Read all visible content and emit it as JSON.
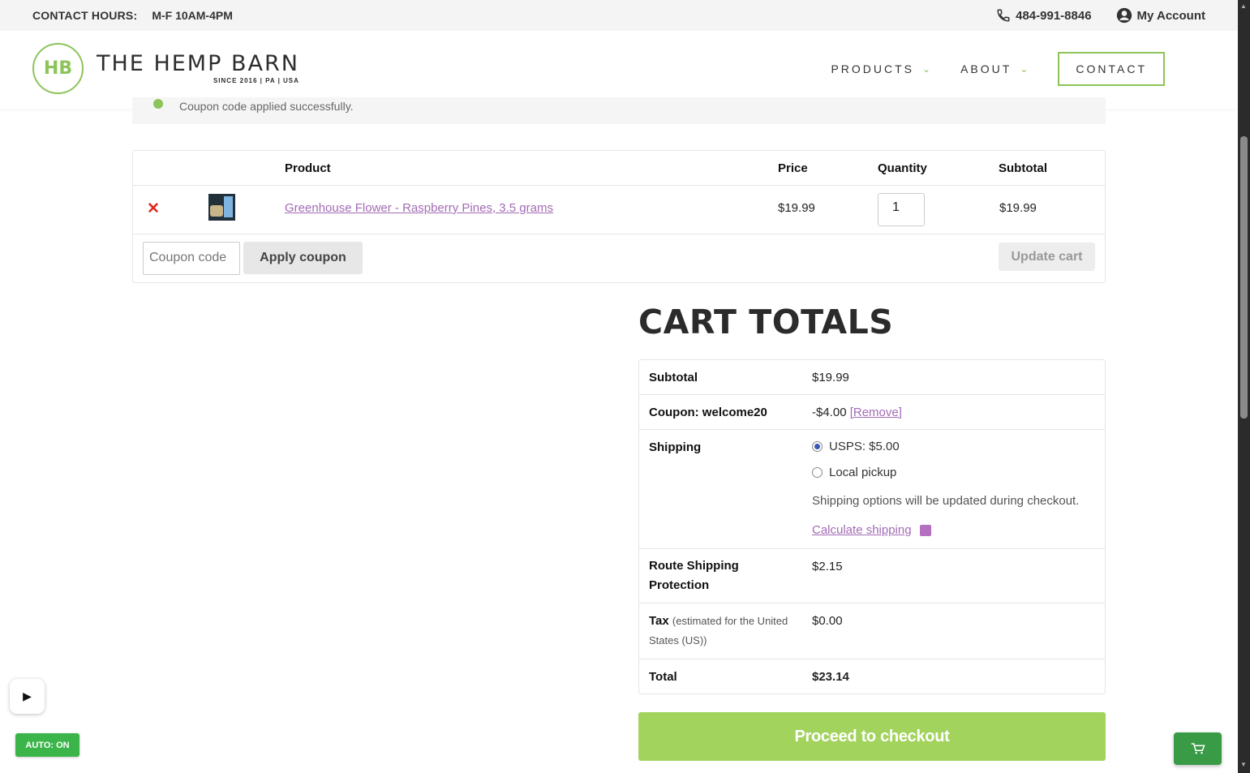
{
  "topbar": {
    "hours_label": "CONTACT HOURS:",
    "hours_value": "M-F 10AM-4PM",
    "phone": "484-991-8846",
    "account": "My Account"
  },
  "header": {
    "logo_mark": "HB",
    "logo_title": "THE HEMP BARN",
    "logo_sub": "SINCE 2016  |  PA  |  USA",
    "nav": {
      "products": "PRODUCTS",
      "about": "ABOUT",
      "contact": "CONTACT"
    }
  },
  "notice": {
    "text": "Coupon code applied successfully."
  },
  "cart": {
    "columns": {
      "product": "Product",
      "price": "Price",
      "quantity": "Quantity",
      "subtotal": "Subtotal"
    },
    "items": [
      {
        "name": "Greenhouse Flower - Raspberry Pines, 3.5 grams",
        "price": "$19.99",
        "quantity": "1",
        "subtotal": "$19.99"
      }
    ],
    "coupon_placeholder": "Coupon code",
    "apply_label": "Apply coupon",
    "update_label": "Update cart"
  },
  "totals": {
    "title": "CART TOTALS",
    "subtotal_label": "Subtotal",
    "subtotal_value": "$19.99",
    "coupon_label": "Coupon: welcome20",
    "coupon_value": "-$4.00",
    "coupon_remove": "[Remove]",
    "shipping_label": "Shipping",
    "shipping_options": [
      {
        "label": "USPS: $5.00",
        "selected": true
      },
      {
        "label": "Local pickup",
        "selected": false
      }
    ],
    "shipping_note": "Shipping options will be updated during checkout.",
    "calculate_shipping": "Calculate shipping",
    "route_label": "Route Shipping Protection",
    "route_value": "$2.15",
    "tax_label": "Tax",
    "tax_note": "(estimated for the United States (US))",
    "tax_value": "$0.00",
    "total_label": "Total",
    "total_value": "$23.14"
  },
  "checkout_label": "Proceed to checkout",
  "widgets": {
    "auto_badge": "AUTO: ON",
    "play_icon": "play-icon",
    "cart_icon": "shopping-cart-icon"
  },
  "colors": {
    "brand_green": "#8cc45a",
    "checkout_green": "#a2d35d",
    "link_purple": "#a36bb5",
    "remove_red": "#e2261c"
  }
}
